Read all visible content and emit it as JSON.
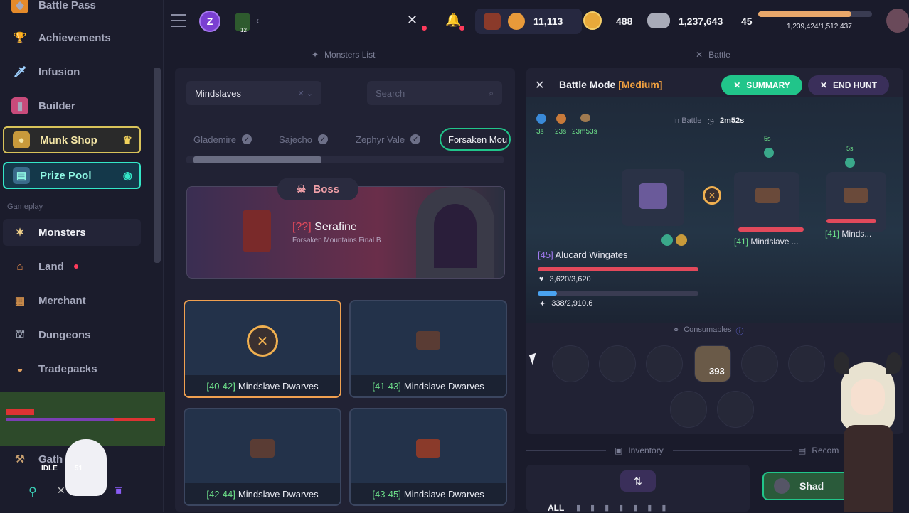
{
  "sidebar": {
    "items": [
      {
        "label": "Battle Pass",
        "icon": "diamond-icon"
      },
      {
        "label": "Achievements",
        "icon": "trophy-icon"
      },
      {
        "label": "Infusion",
        "icon": "sword-icon"
      },
      {
        "label": "Builder",
        "icon": "book-icon"
      },
      {
        "label": "Munk Shop",
        "icon": "cat-icon"
      },
      {
        "label": "Prize Pool",
        "icon": "chest-icon"
      },
      {
        "label": "Monsters",
        "icon": "bee-icon"
      },
      {
        "label": "Land",
        "icon": "house-icon"
      },
      {
        "label": "Merchant",
        "icon": "cart-icon"
      },
      {
        "label": "Dungeons",
        "icon": "tomb-icon"
      },
      {
        "label": "Tradepacks",
        "icon": "bag-icon"
      },
      {
        "label": "Gath",
        "icon": "axe-icon"
      }
    ],
    "section_gameplay": "Gameplay",
    "overlay_text": "IDLE",
    "overlay_number": "51"
  },
  "topbar": {
    "energy": "11,113",
    "coins": "488",
    "silver": "1,237,643",
    "level": "45",
    "xp_text": "1,239,424/1,512,437",
    "xp_fraction": 0.82,
    "extra_badge": "12"
  },
  "monsters": {
    "title": "Monsters List",
    "select_value": "Mindslaves",
    "search_placeholder": "Search",
    "tabs": [
      "Glademire",
      "Sajecho",
      "Zephyr Vale",
      "Forsaken Mou"
    ],
    "boss_label": "Boss",
    "boss_level": "[??]",
    "boss_name": "Serafine",
    "boss_sub": "Forsaken Mountains Final B",
    "cards": [
      {
        "level": "[40-42]",
        "name": "Mindslave Dwarves"
      },
      {
        "level": "[41-43]",
        "name": "Mindslave Dwarves"
      },
      {
        "level": "[42-44]",
        "name": "Mindslave Dwarves"
      },
      {
        "level": "[43-45]",
        "name": "Mindslave Dwarves"
      }
    ]
  },
  "battle": {
    "title": "Battle",
    "mode_label": "Battle Mode",
    "mode_value": "[Medium]",
    "summary_label": "SUMMARY",
    "end_label": "END HUNT",
    "timers": [
      "3s",
      "23s",
      "23m53s"
    ],
    "in_battle_label": "In Battle",
    "in_battle_time": "2m52s",
    "player_level": "[45]",
    "player_name": "Alucard Wingates",
    "hp_text": "3,620/3,620",
    "hp_fraction": 1.0,
    "mp_text": "338/2,910.6",
    "mp_fraction": 0.12,
    "enemies": [
      {
        "level": "[41]",
        "name": "Mindslave ...",
        "timer": "5s"
      },
      {
        "level": "[41]",
        "name": "Minds...",
        "timer": "5s"
      }
    ],
    "consumables_label": "Consumables",
    "consumable_count": "393"
  },
  "inventory": {
    "title": "Inventory",
    "recom_title": "Recom",
    "filter_all": "ALL",
    "shadow_btn": "Shad"
  },
  "colors": {
    "accent_green": "#21c58a",
    "accent_gold": "#e8b04a",
    "hp_red": "#e2495b",
    "mp_blue": "#4aa3f0"
  }
}
